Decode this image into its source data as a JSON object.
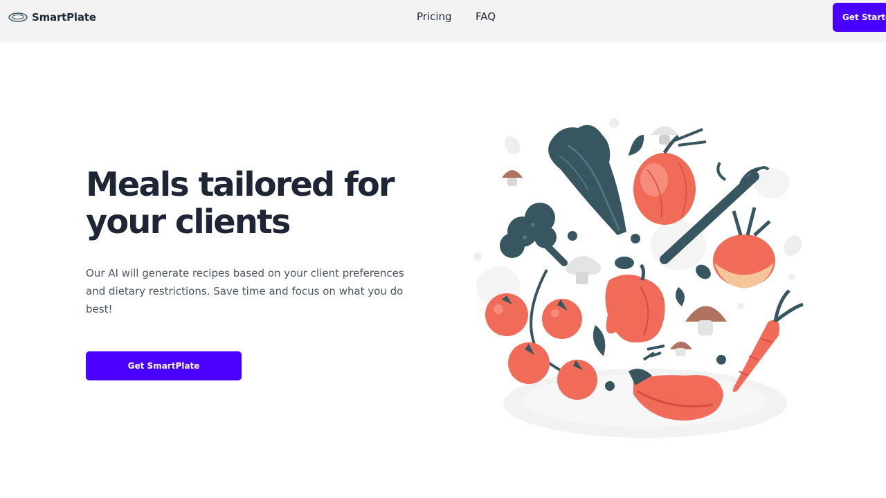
{
  "brand": {
    "name": "SmartPlate"
  },
  "nav": {
    "links": [
      "Pricing",
      "FAQ"
    ],
    "cta_label": "Get Started"
  },
  "hero": {
    "title_line1": "Meals tailored for",
    "title_line2": "your clients",
    "description": "Our AI will generate recipes based on your client preferences and dietary restrictions. Save time and focus on what you do best!",
    "cta_label": "Get SmartPlate"
  },
  "colors": {
    "accent": "#4a00ff",
    "navbar_bg": "#f3f3f3",
    "title": "#1e2535",
    "body_text": "#4b5563",
    "veg_dark": "#37565f",
    "veg_red": "#f06b58",
    "veg_brown": "#b0735f"
  },
  "illustration": {
    "icon": "vegetables-illustration"
  }
}
